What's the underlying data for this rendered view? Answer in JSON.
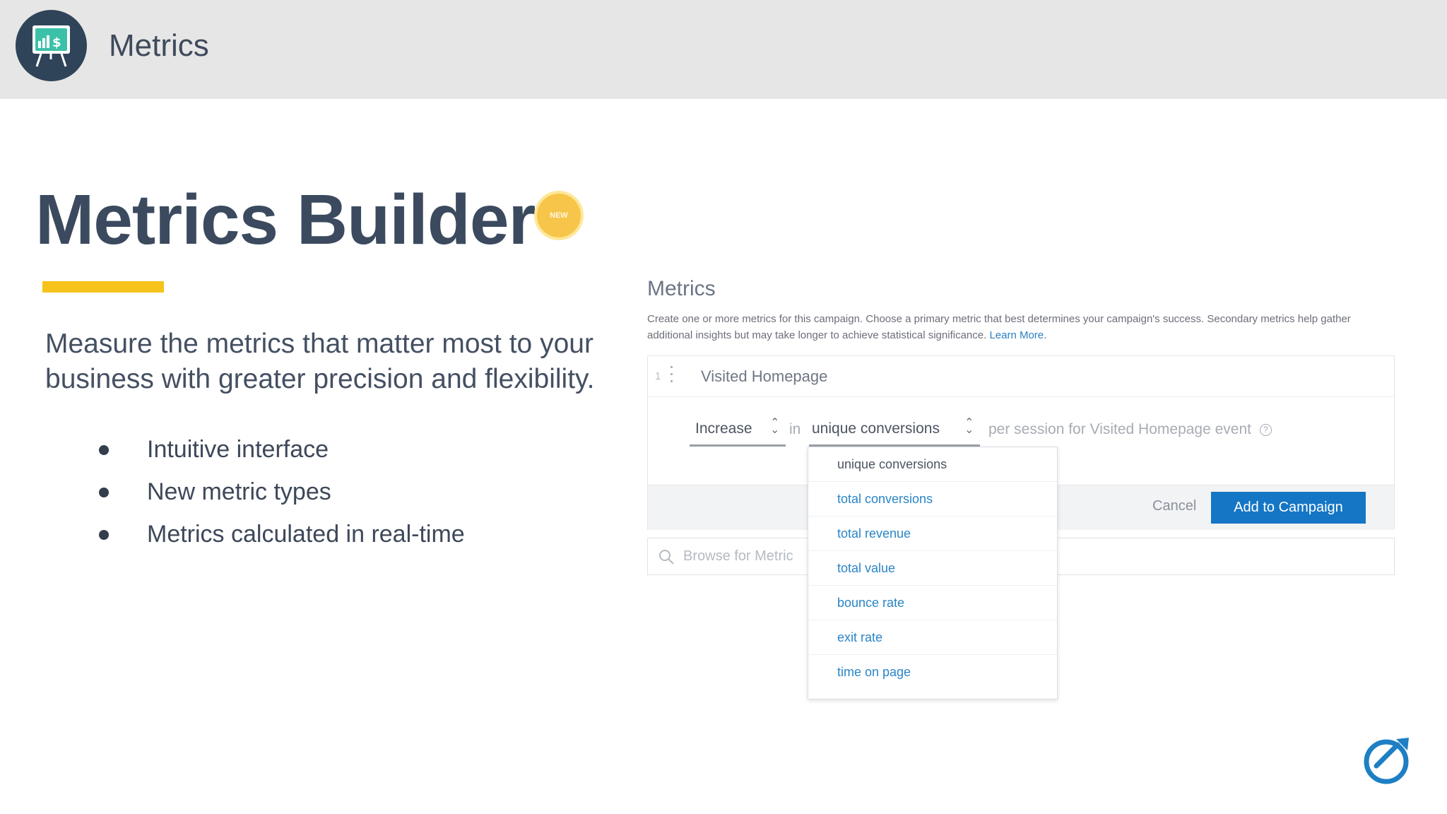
{
  "header": {
    "title": "Metrics",
    "logo_icon": "presentation-board-chart-icon",
    "logo_text": " $"
  },
  "left": {
    "title": "Metrics Builder",
    "badge": "NEW",
    "lead": "Measure the metrics that matter most to your business with greater precision and flexibility.",
    "bullets": [
      "Intuitive interface",
      "New metric types",
      "Metrics calculated in real-time"
    ]
  },
  "panel": {
    "heading": "Metrics",
    "description": "Create one or more metrics for this campaign. Choose a primary metric that best determines your campaign's success. Secondary metrics help gather additional insights but may take longer to achieve statistical significance.",
    "learn_more": "Learn More.",
    "metric_row": {
      "index": "1",
      "name": "Visited Homepage",
      "direction": "Increase",
      "in_text": "in",
      "metric": "unique conversions",
      "suffix": "per session for Visited Homepage event",
      "help": "?"
    },
    "cancel": "Cancel",
    "add": "Add to Campaign",
    "browse_placeholder": "Browse for Metric"
  },
  "dropdown": {
    "options": [
      "unique conversions",
      "total conversions",
      "total revenue",
      "total value",
      "bounce rate",
      "exit rate",
      "time on page"
    ],
    "selected_index": 0
  },
  "colors": {
    "header_bg": "#e6e6e6",
    "title": "#3b4a5e",
    "accent_yellow": "#f6c31a",
    "primary_button": "#1576c5",
    "link_blue": "#2a85c7"
  }
}
